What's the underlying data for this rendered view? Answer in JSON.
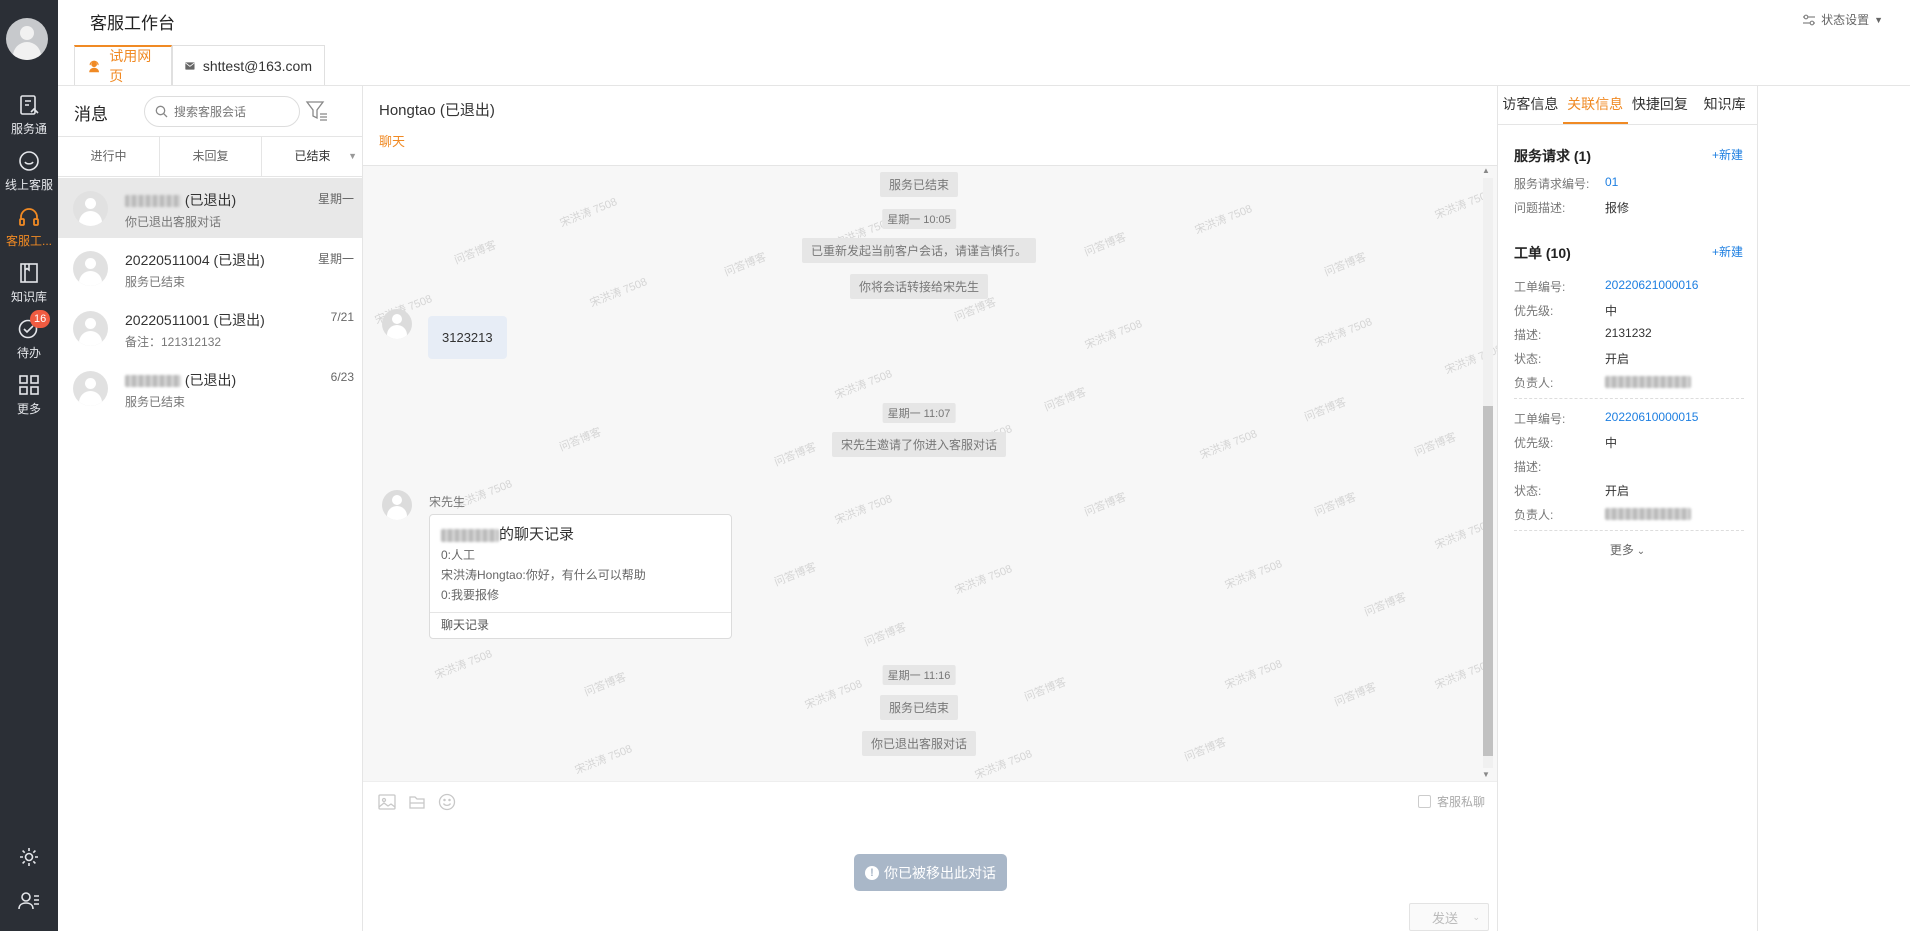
{
  "header": {
    "title": "客服工作台",
    "status_setting": "状态设置",
    "tabs": [
      {
        "label": "试用网页",
        "active": true
      },
      {
        "label": "shttest@163.com",
        "active": false
      }
    ]
  },
  "nav": {
    "items": [
      {
        "label": "服务通",
        "icon": "service-icon"
      },
      {
        "label": "线上客服",
        "icon": "smile-icon"
      },
      {
        "label": "客服工...",
        "icon": "headset-icon",
        "active": true
      },
      {
        "label": "知识库",
        "icon": "book-icon"
      },
      {
        "label": "待办",
        "icon": "check-circle-icon",
        "badge": "16"
      },
      {
        "label": "更多",
        "icon": "grid-icon"
      }
    ],
    "bottom_icons": [
      "gear-icon",
      "user-list-icon"
    ]
  },
  "list": {
    "title": "消息",
    "search_placeholder": "搜索客服会话",
    "tabs": [
      "进行中",
      "未回复",
      "已结束"
    ],
    "conversations": [
      {
        "name_suffix": " (已退出)",
        "name_redacted": true,
        "time": "星期一",
        "preview": "你已退出客服对话",
        "active": true
      },
      {
        "name": "20220511004 (已退出)",
        "time": "星期一",
        "preview": "服务已结束"
      },
      {
        "name": "20220511001 (已退出)",
        "time": "7/21",
        "preview": "备注：121312132"
      },
      {
        "name_suffix": " (已退出)",
        "name_redacted": true,
        "time": "6/23",
        "preview": "服务已结束"
      }
    ]
  },
  "chat": {
    "title": "Hongtao (已退出)",
    "tab": "聊天",
    "messages": {
      "sys1": "服务已结束",
      "time1": "星期一 10:05",
      "sys2": "已重新发起当前客户会话，请谨言慎行。",
      "sys3": "你将会话转接给宋先生",
      "bubble1": "3123213",
      "time2": "星期一 11:07",
      "sys4": "宋先生邀请了你进入客服对话",
      "sender": "宋先生",
      "record_title_suffix": "的聊天记录",
      "record_lines": [
        "0:人工",
        "宋洪涛Hongtao:你好，有什么可以帮助",
        "0:我要报修"
      ],
      "record_footer": "聊天记录",
      "time3": "星期一 11:16",
      "sys5": "服务已结束",
      "sys6": "你已退出客服对话"
    },
    "watermark_texts": [
      "宋洪涛 7508",
      "问答博客"
    ],
    "private_chat": "客服私聊",
    "removed_notice": "你已被移出此对话",
    "send": "发送"
  },
  "right_panel": {
    "tabs": [
      "访客信息",
      "关联信息",
      "快捷回复",
      "知识库"
    ],
    "active_tab": 1,
    "service_request": {
      "title": "服务请求 (1)",
      "new": "+新建",
      "fields": [
        {
          "k": "服务请求编号:",
          "v": "01",
          "link": true
        },
        {
          "k": "问题描述:",
          "v": "报修"
        }
      ]
    },
    "tickets": {
      "title": "工单 (10)",
      "new": "+新建",
      "items": [
        {
          "no_label": "工单编号:",
          "no": "20220621000016",
          "priority_label": "优先级:",
          "priority": "中",
          "desc_label": "描述:",
          "desc": "2131232",
          "status_label": "状态:",
          "status": "开启",
          "owner_label": "负责人:"
        },
        {
          "no_label": "工单编号:",
          "no": "20220610000015",
          "priority_label": "优先级:",
          "priority": "中",
          "desc_label": "描述:",
          "desc": "",
          "status_label": "状态:",
          "status": "开启",
          "owner_label": "负责人:"
        }
      ],
      "more": "更多"
    }
  },
  "colors": {
    "accent": "#f08a24",
    "link": "#1e7fe1",
    "nav_bg": "#2b2f36",
    "badge": "#f05b41"
  }
}
